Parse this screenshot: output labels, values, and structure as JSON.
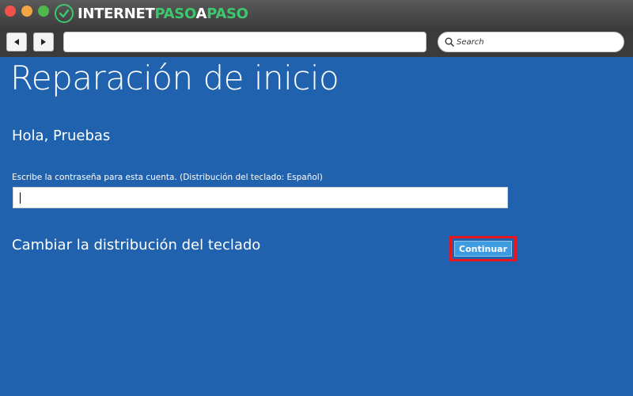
{
  "browser": {
    "brand_white_1": "INTERNET",
    "brand_green_1": "PASO",
    "brand_white_2": "A",
    "brand_green_2": "PASO",
    "search_label": "Search",
    "traffic_colors": [
      "#f2514b",
      "#f5a443",
      "#4fb94d"
    ]
  },
  "page": {
    "title": "Reparación de inicio",
    "greeting": "Hola, Pruebas",
    "password_label": "Escribe la contraseña para esta cuenta. (Distribución del teclado: Español)",
    "password_value": "",
    "keyboard_link": "Cambiar la distribución del teclado",
    "continue_label": "Continuar",
    "background_color": "#2062ae",
    "highlight_color": "#e8161e"
  }
}
